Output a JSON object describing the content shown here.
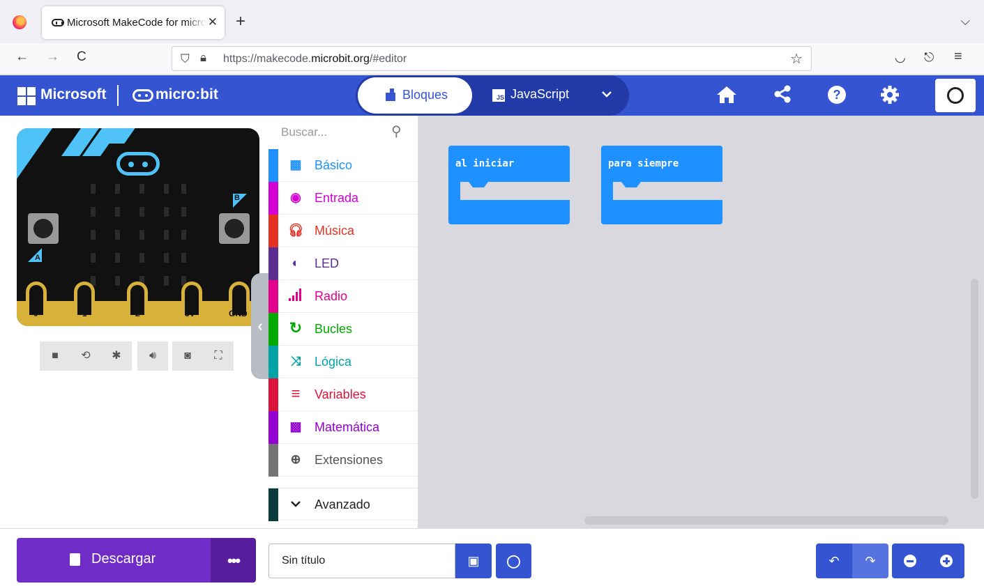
{
  "browser": {
    "tab_title": "Microsoft MakeCode for micro:bit",
    "tab_close": "✕",
    "new_tab": "+",
    "tab_list": "⌵",
    "url_prefix": "https://makecode.",
    "url_domain": "microbit.org",
    "url_suffix": "/#editor",
    "back": "←",
    "forward": "→",
    "reload": "C"
  },
  "header": {
    "brand": "Microsoft",
    "product": "micro:bit",
    "mode_blocks": "Bloques",
    "mode_js": "JavaScript",
    "js_badge": "JS",
    "dropdown": "⌄",
    "icons": [
      "home-icon",
      "share-icon",
      "help-icon",
      "settings-icon",
      "profile-icon"
    ]
  },
  "simulator": {
    "button_a": "A",
    "button_b": "B",
    "pins": [
      "0",
      "1",
      "2",
      "3V",
      "GND"
    ],
    "controls": [
      "stop-icon",
      "restart-icon",
      "debug-icon",
      "mute-icon",
      "screenshot-icon",
      "fullscreen-icon"
    ]
  },
  "toolbox": {
    "search_placeholder": "Buscar...",
    "categories": [
      {
        "label": "Básico",
        "color": "#1e90ff",
        "icon": "grid-icon"
      },
      {
        "label": "Entrada",
        "color": "#d400d4",
        "icon": "input-icon"
      },
      {
        "label": "Música",
        "color": "#e63022",
        "icon": "headphones-icon"
      },
      {
        "label": "LED",
        "color": "#5c2d91",
        "icon": "toggle-icon"
      },
      {
        "label": "Radio",
        "color": "#e3008c",
        "icon": "signal-icon"
      },
      {
        "label": "Bucles",
        "color": "#00aa00",
        "icon": "loop-icon"
      },
      {
        "label": "Lógica",
        "color": "#00a4a6",
        "icon": "shuffle-icon"
      },
      {
        "label": "Variables",
        "color": "#dc143c",
        "icon": "list-icon"
      },
      {
        "label": "Matemática",
        "color": "#9400d3",
        "icon": "calculator-icon"
      },
      {
        "label": "Extensiones",
        "color": "#757575",
        "icon": "plus-circle-icon"
      }
    ],
    "advanced": "Avanzado",
    "advanced_color": "#0b3a3f"
  },
  "workspace": {
    "blocks": [
      {
        "label": "al iniciar"
      },
      {
        "label": "para siempre"
      }
    ]
  },
  "footer": {
    "download": "Descargar",
    "more": "•••",
    "project_name": "Sin título"
  },
  "colors": {
    "header": "#3454d1",
    "download": "#6f2cc7",
    "block": "#1e90ff"
  }
}
